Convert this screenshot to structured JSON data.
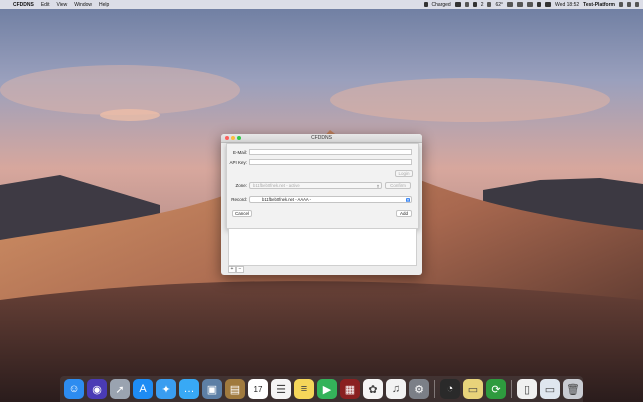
{
  "menubar": {
    "apple_glyph": "",
    "app_name": "CFDDNS",
    "menus": [
      "Edit",
      "View",
      "Window",
      "Help"
    ],
    "status": {
      "battery_label": "Charged",
      "indicator": "2",
      "temperature": "62°",
      "clock": "Wed 18:52",
      "user": "Test-Platform"
    }
  },
  "window": {
    "title": "CFDDNS"
  },
  "form": {
    "email_label": "E-Mail:",
    "email_value": "",
    "apikey_label": "API Key:",
    "apikey_value": "",
    "login_button": "Login",
    "zone_label": "Zone:",
    "zone_value": "b11fbeb0fnek.net - active",
    "confirm_button": "Confirm",
    "record_label": "Record:",
    "record_value": "b11fbeb0fnek.net - AAAA -",
    "cancel_button": "Cancel",
    "add_button": "Add"
  },
  "list_controls": {
    "add": "+",
    "remove": "−"
  },
  "colors": {
    "accent": "#3a86f5",
    "close": "#fc605c",
    "minimize": "#fdbc40",
    "zoom": "#34c84a"
  },
  "dock": {
    "items": [
      {
        "name": "finder-icon",
        "bg": "#2d8cf0",
        "glyph": "☺"
      },
      {
        "name": "siri-icon",
        "bg": "#4a3bb5",
        "glyph": "◉"
      },
      {
        "name": "launchpad-icon",
        "bg": "#9aa3b0",
        "glyph": "➚"
      },
      {
        "name": "app-store-icon",
        "bg": "#1e8cf4",
        "glyph": "A"
      },
      {
        "name": "safari-icon",
        "bg": "#3a9df0",
        "glyph": "✦"
      },
      {
        "name": "messages-icon",
        "bg": "#38a9f5",
        "glyph": "…"
      },
      {
        "name": "preview-icon",
        "bg": "#5d7fa5",
        "glyph": "▣"
      },
      {
        "name": "notebook-icon",
        "bg": "#a07a3e",
        "glyph": "▤"
      },
      {
        "name": "calendar-icon",
        "bg": "#ffffff",
        "glyph": "17"
      },
      {
        "name": "reminders-icon",
        "bg": "#f4f4f4",
        "glyph": "☰"
      },
      {
        "name": "notes-icon",
        "bg": "#f5d65a",
        "glyph": "≡"
      },
      {
        "name": "facetime-icon",
        "bg": "#34b35a",
        "glyph": "▶"
      },
      {
        "name": "photo-booth-icon",
        "bg": "#8a2121",
        "glyph": "▦"
      },
      {
        "name": "photos-icon",
        "bg": "#f5f5f5",
        "glyph": "✿"
      },
      {
        "name": "itunes-icon",
        "bg": "#f2f2f2",
        "glyph": "♫"
      },
      {
        "name": "system-preferences-icon",
        "bg": "#7b7f87",
        "glyph": "⚙"
      },
      {
        "name": "sep",
        "bg": "",
        "glyph": ""
      },
      {
        "name": "istat-icon",
        "bg": "#2a2a2a",
        "glyph": "◔"
      },
      {
        "name": "stickies-icon",
        "bg": "#e8d37a",
        "glyph": "▭"
      },
      {
        "name": "cfddns-icon",
        "bg": "#2e9b3e",
        "glyph": "⟳"
      },
      {
        "name": "sep",
        "bg": "",
        "glyph": ""
      },
      {
        "name": "document-icon",
        "bg": "#f0f0f0",
        "glyph": "▯"
      },
      {
        "name": "screenshot-icon",
        "bg": "#dfe6ee",
        "glyph": "▭"
      },
      {
        "name": "trash-icon",
        "bg": "#c9ccd2",
        "glyph": "🗑"
      }
    ]
  }
}
